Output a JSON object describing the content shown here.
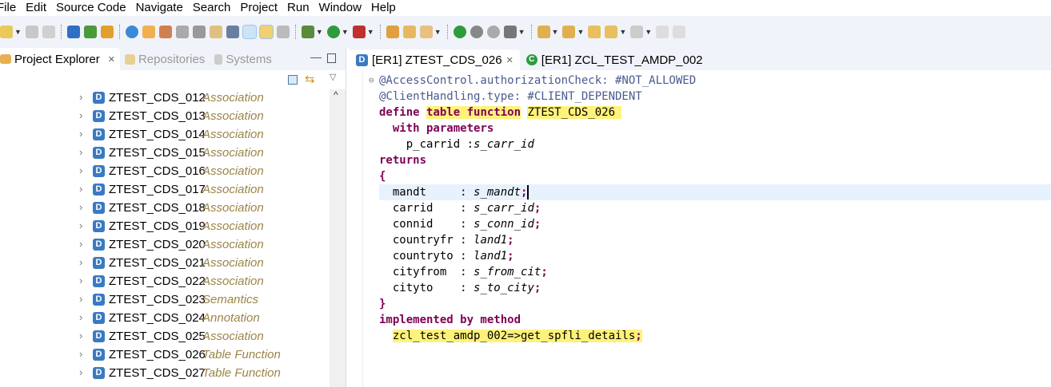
{
  "menu": [
    "File",
    "Edit",
    "Source Code",
    "Navigate",
    "Search",
    "Project",
    "Run",
    "Window",
    "Help"
  ],
  "left_tabs": {
    "project_explorer": "Project Explorer",
    "repositories": "Repositories",
    "systems": "Systems"
  },
  "tree": [
    {
      "name": "ZTEST_CDS_012",
      "type": "Association"
    },
    {
      "name": "ZTEST_CDS_013",
      "type": "Association"
    },
    {
      "name": "ZTEST_CDS_014",
      "type": "Association"
    },
    {
      "name": "ZTEST_CDS_015",
      "type": "Association"
    },
    {
      "name": "ZTEST_CDS_016",
      "type": "Association"
    },
    {
      "name": "ZTEST_CDS_017",
      "type": "Association"
    },
    {
      "name": "ZTEST_CDS_018",
      "type": "Association"
    },
    {
      "name": "ZTEST_CDS_019",
      "type": "Association"
    },
    {
      "name": "ZTEST_CDS_020",
      "type": "Association"
    },
    {
      "name": "ZTEST_CDS_021",
      "type": "Association"
    },
    {
      "name": "ZTEST_CDS_022",
      "type": "Association"
    },
    {
      "name": "ZTEST_CDS_023",
      "type": "Semantics"
    },
    {
      "name": "ZTEST_CDS_024",
      "type": "Annotation"
    },
    {
      "name": "ZTEST_CDS_025",
      "type": "Association"
    },
    {
      "name": "ZTEST_CDS_026",
      "type": "Table Function"
    },
    {
      "name": "ZTEST_CDS_027",
      "type": "Table Function"
    }
  ],
  "editor_tabs": [
    {
      "label": "[ER1] ZTEST_CDS_026",
      "icon": "D"
    },
    {
      "label": "[ER1] ZCL_TEST_AMDP_002",
      "icon": "C"
    }
  ],
  "code": {
    "l1": "@AccessControl.authorizationCheck: #NOT_ALLOWED",
    "l2": "@ClientHandling.type: #CLIENT_DEPENDENT",
    "define": "define",
    "table_function": "table function",
    "entity": "ZTEST_CDS_026 ",
    "with_params": "with parameters",
    "p_name": "p_carrid :",
    "p_type": "s_carr_id",
    "returns": "returns",
    "open": "{",
    "close": "}",
    "fields": [
      {
        "name": "mandt     : ",
        "type": "s_mandt"
      },
      {
        "name": "carrid    : ",
        "type": "s_carr_id"
      },
      {
        "name": "connid    : ",
        "type": "s_conn_id"
      },
      {
        "name": "countryfr : ",
        "type": "land1"
      },
      {
        "name": "countryto : ",
        "type": "land1"
      },
      {
        "name": "cityfrom  : ",
        "type": "s_from_cit"
      },
      {
        "name": "cityto    : ",
        "type": "s_to_city"
      }
    ],
    "implemented": "implemented by method",
    "method": "zcl_test_amdp_002=>get_spfli_details"
  }
}
